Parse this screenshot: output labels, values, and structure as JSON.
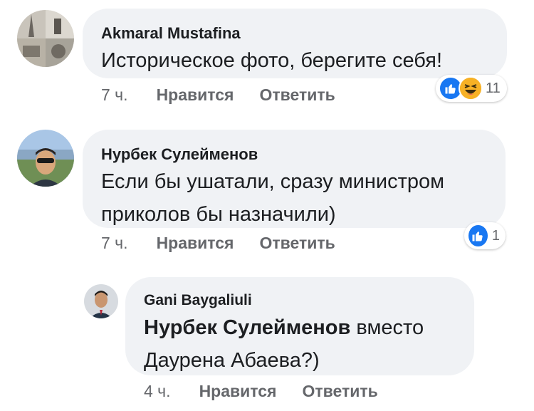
{
  "comments": [
    {
      "author": "Akmaral Mustafina",
      "text": "Историческое фото, берегите себя!",
      "time": "7 ч.",
      "like_label": "Нравится",
      "reply_label": "Ответить",
      "reactions": {
        "types": [
          "like-icon",
          "haha-icon"
        ],
        "count": "11"
      }
    },
    {
      "author": "Нурбек Сулейменов",
      "text": "Если бы ушатали, сразу министром приколов бы назначили)",
      "time": "7 ч.",
      "like_label": "Нравится",
      "reply_label": "Ответить",
      "reactions": {
        "types": [
          "like-icon"
        ],
        "count": "1"
      }
    }
  ],
  "reply": {
    "author": "Gani Baygaliuli",
    "mention": "Нурбек Сулейменов",
    "text": " вместо Даурена Абаева?)",
    "time": "4 ч.",
    "like_label": "Нравится",
    "reply_label": "Ответить"
  },
  "colors": {
    "bubble": "#f0f2f5",
    "meta": "#65676b",
    "like": "#1877f2",
    "haha": "#f7b125"
  }
}
